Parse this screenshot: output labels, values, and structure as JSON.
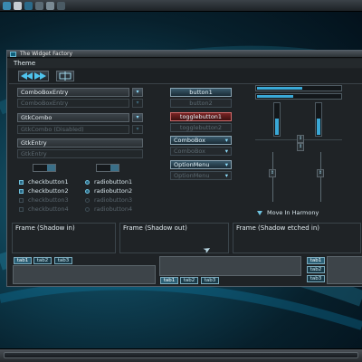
{
  "window": {
    "title": "The Widget Factory"
  },
  "menu": {
    "theme": "Theme"
  },
  "toolbar": {
    "icons": [
      "back-icon",
      "forward-icon",
      "fullscreen-icon"
    ]
  },
  "left": {
    "combo_entry": "ComboBoxEntry",
    "combo_entry_disabled": "ComboBoxEntry",
    "gtk_combo": "GtkCombo",
    "gtk_combo_disabled": "GtkCombo (Disabled)",
    "gtk_entry": "GtkEntry",
    "gtk_entry_disabled": "GtkEntry",
    "checkbuttons": [
      "checkbutton1",
      "checkbutton2",
      "checkbutton3",
      "checkbutton4"
    ],
    "radiobuttons": [
      "radiobutton1",
      "radiobutton2",
      "radiobutton3",
      "radiobutton4"
    ]
  },
  "middle": {
    "button1": "button1",
    "button2": "button2",
    "toggle1": "togglebutton1",
    "toggle2": "togglebutton2",
    "combo1": "ComboBox",
    "combo2": "ComboBox",
    "option1": "OptionMenu",
    "option2": "OptionMenu"
  },
  "right": {
    "move_label": "Move In Harmony",
    "vslider_left_level": 0.55,
    "vslider_right_level": 0.55,
    "hslider_top_level": 0.55,
    "hslider_bottom_level": 0.45
  },
  "frames": {
    "in": "Frame (Shadow in)",
    "out": "Frame (Shadow out)",
    "etched": "Frame (Shadow etched in)"
  },
  "notebooks": {
    "top_tabs": [
      "tab1",
      "tab2",
      "tab3"
    ],
    "bottom_tabs": [
      "tab1",
      "tab2",
      "tab3"
    ],
    "right_tabs": [
      "tab1",
      "tab2",
      "tab3"
    ]
  },
  "colors": {
    "accent": "#3aa8d6",
    "toggle_active": "#7a2424",
    "window_bg": "#1f2326"
  }
}
